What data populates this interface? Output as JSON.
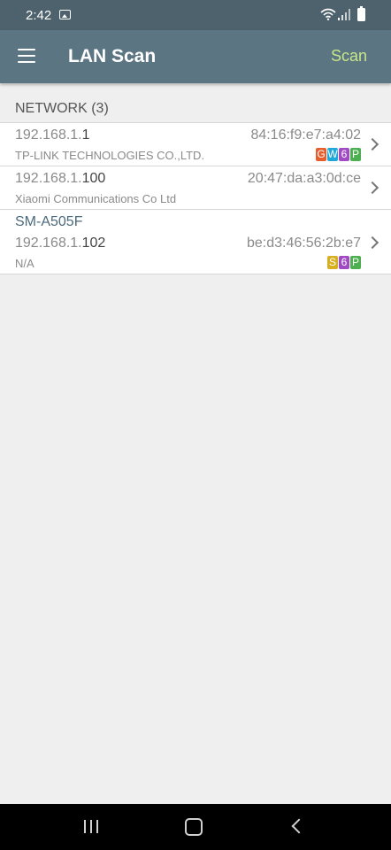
{
  "status_bar": {
    "time": "2:42"
  },
  "app_bar": {
    "title": "LAN Scan",
    "scan_label": "Scan"
  },
  "network": {
    "header": "NETWORK (3)",
    "devices": [
      {
        "hostname": "",
        "ip_prefix": "192.168.1.",
        "ip_suffix": "1",
        "mac": "84:16:f9:e7:a4:02",
        "vendor": "TP-LINK TECHNOLOGIES CO.,LTD.",
        "badges": [
          {
            "letter": "G",
            "color": "#e85d2c"
          },
          {
            "letter": "W",
            "color": "#20a9d8"
          },
          {
            "letter": "6",
            "color": "#a04bc4"
          },
          {
            "letter": "P",
            "color": "#4caf50"
          }
        ]
      },
      {
        "hostname": "",
        "ip_prefix": "192.168.1.",
        "ip_suffix": "100",
        "mac": "20:47:da:a3:0d:ce",
        "vendor": "Xiaomi Communications Co Ltd",
        "badges": []
      },
      {
        "hostname": "SM-A505F",
        "ip_prefix": "192.168.1.",
        "ip_suffix": "102",
        "mac": "be:d3:46:56:2b:e7",
        "vendor": "N/A",
        "badges": [
          {
            "letter": "S",
            "color": "#d7b021"
          },
          {
            "letter": "6",
            "color": "#a04bc4"
          },
          {
            "letter": "P",
            "color": "#4caf50"
          }
        ]
      }
    ]
  },
  "icons": {
    "menu": "hamburger-menu-icon",
    "gallery": "gallery-notification-icon",
    "wifi": "wifi-icon",
    "signal": "signal-icon",
    "battery": "battery-icon",
    "chevron": "chevron-right-icon",
    "nav_recents": "recents-icon",
    "nav_home": "home-icon",
    "nav_back": "back-icon"
  }
}
